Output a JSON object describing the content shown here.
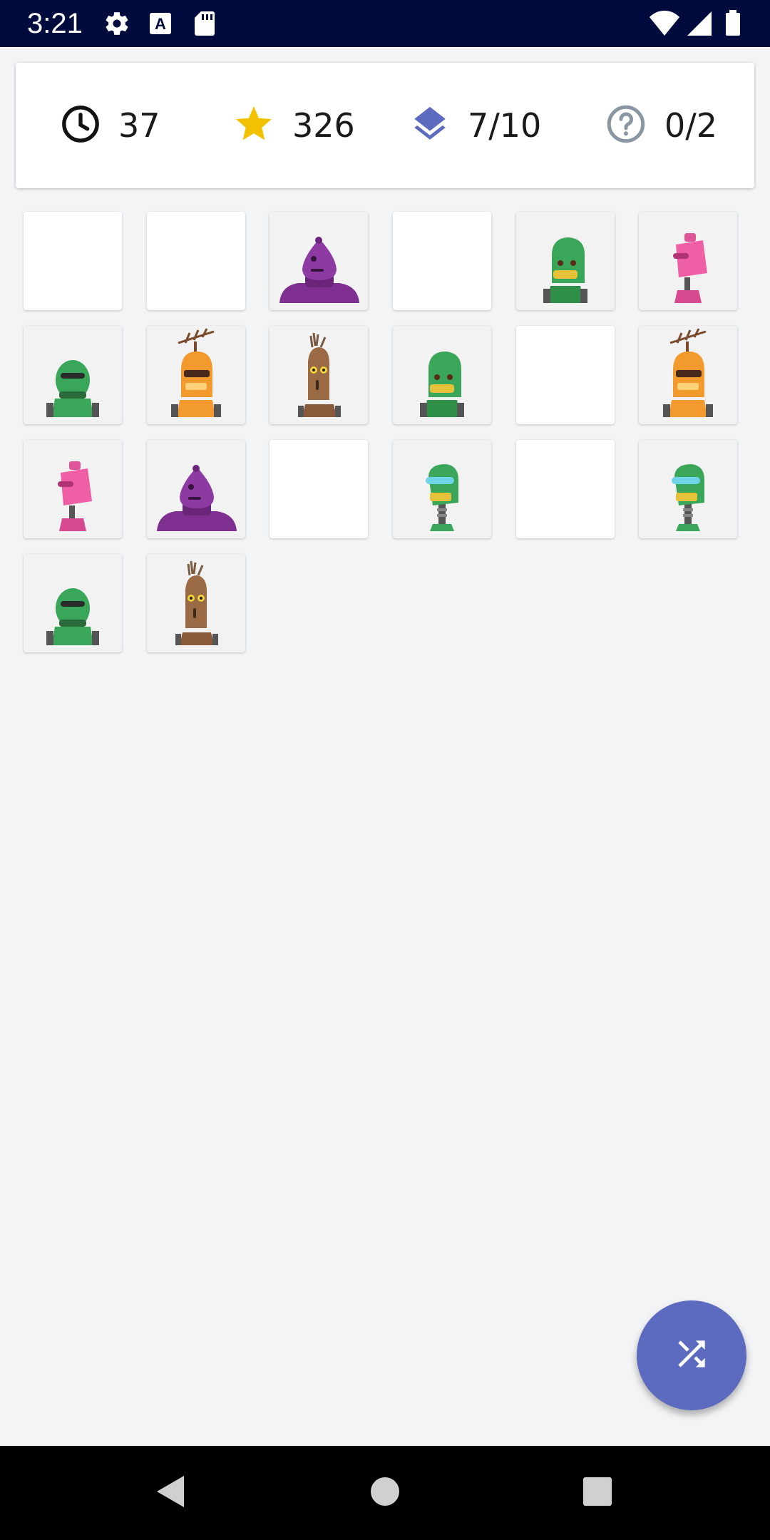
{
  "status_bar": {
    "time": "3:21",
    "left_icons": [
      "gear-icon",
      "text-a-icon",
      "sd-card-icon"
    ],
    "right_icons": [
      "wifi-icon",
      "signal-icon",
      "battery-icon"
    ]
  },
  "stats": {
    "time": {
      "icon": "clock-icon",
      "value": "37"
    },
    "score": {
      "icon": "star-icon",
      "value": "326",
      "color": "#f2c200"
    },
    "level": {
      "icon": "layers-icon",
      "value": "7/10",
      "color": "#5c6bc0"
    },
    "hints": {
      "icon": "help-circle-icon",
      "value": "0/2",
      "color": "#8a97a3"
    }
  },
  "board": {
    "tiles": [
      {
        "robot": "none"
      },
      {
        "robot": "none"
      },
      {
        "robot": "purple-blob"
      },
      {
        "robot": "none"
      },
      {
        "robot": "green-grin"
      },
      {
        "robot": "pink-box"
      },
      {
        "robot": "green-visor"
      },
      {
        "robot": "orange-antenna"
      },
      {
        "robot": "brown-sprout"
      },
      {
        "robot": "green-grin"
      },
      {
        "robot": "none"
      },
      {
        "robot": "orange-antenna"
      },
      {
        "robot": "pink-box"
      },
      {
        "robot": "purple-blob"
      },
      {
        "robot": "none"
      },
      {
        "robot": "green-goggles"
      },
      {
        "robot": "none"
      },
      {
        "robot": "green-goggles"
      },
      {
        "robot": "green-visor"
      },
      {
        "robot": "brown-sprout"
      }
    ]
  },
  "fab": {
    "icon": "shuffle-icon",
    "color": "#5c6bc0"
  },
  "nav_bar": {
    "buttons": [
      "back-icon",
      "home-icon",
      "recents-icon"
    ]
  }
}
